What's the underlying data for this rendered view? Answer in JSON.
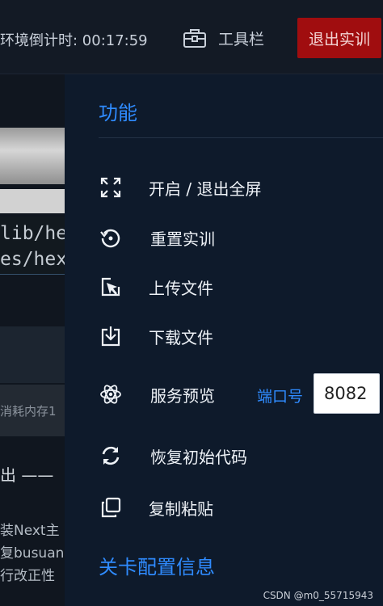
{
  "header": {
    "countdown_text": "环境倒计时: 00:17:59",
    "toolbar_label": "工具栏",
    "exit_label": "退出实训"
  },
  "background": {
    "terminal_line_1": "lib/he",
    "terminal_line_2": "es/hex",
    "memory_text": "消耗内存1",
    "output_text": "出 ——",
    "log_line_1": "装Next主",
    "log_line_2": "复busuan",
    "log_line_3": "行改正性"
  },
  "panel": {
    "title": "功能",
    "items": [
      {
        "label": "开启 / 退出全屏",
        "icon": "fullscreen-icon"
      },
      {
        "label": "重置实训",
        "icon": "reset-icon"
      },
      {
        "label": "上传文件",
        "icon": "upload-icon"
      },
      {
        "label": "下载文件",
        "icon": "download-icon"
      },
      {
        "label": "服务预览",
        "icon": "atom-icon"
      },
      {
        "label": "恢复初始代码",
        "icon": "refresh-icon"
      },
      {
        "label": "复制粘贴",
        "icon": "copy-icon"
      }
    ],
    "port_label": "端口号",
    "port_value": "8082",
    "section2_title": "关卡配置信息"
  },
  "watermark": "CSDN @m0_55715943",
  "colors": {
    "accent_blue": "#2f8bff",
    "exit_red": "#a00d0f",
    "panel_bg": "#0e1a2b",
    "topbar_bg": "#131a25"
  }
}
